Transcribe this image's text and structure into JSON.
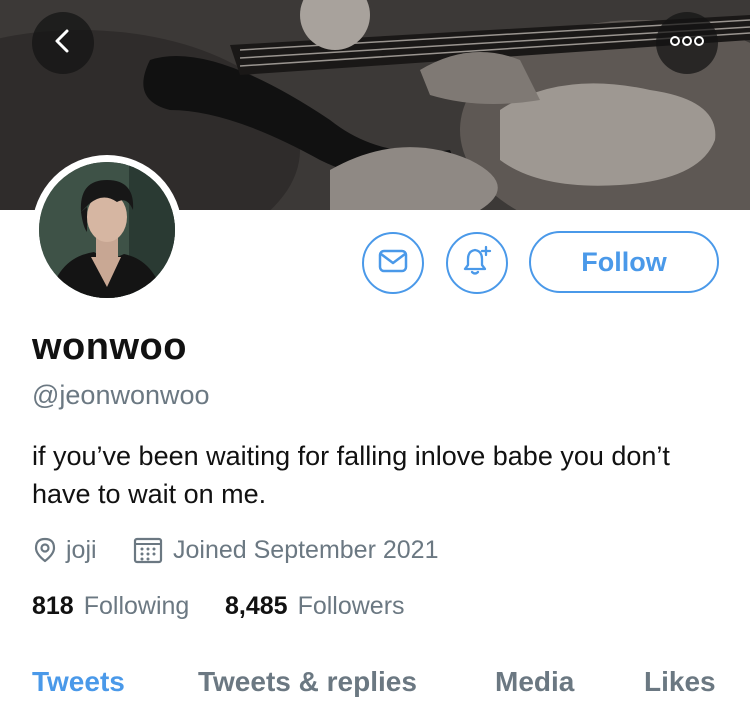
{
  "header": {
    "back_icon": "chevron-left-icon",
    "more_icon": "more-horizontal-icon"
  },
  "profile": {
    "name": "wonwoo",
    "handle": "@jeonwonwoo",
    "bio": "if you’ve been waiting for falling inlove babe you don’t have to wait on me.",
    "location": "joji",
    "joined": "Joined September 2021",
    "following_count": "818",
    "following_label": "Following",
    "followers_count": "8,485",
    "followers_label": "Followers"
  },
  "actions": {
    "message_icon": "mail-icon",
    "notify_icon": "bell-plus-icon",
    "follow_label": "Follow"
  },
  "tabs": [
    {
      "label": "Tweets",
      "active": true
    },
    {
      "label": "Tweets & replies",
      "active": false
    },
    {
      "label": "Media",
      "active": false
    },
    {
      "label": "Likes",
      "active": false
    }
  ],
  "colors": {
    "accent": "#4a99e9",
    "secondary_text": "#6b7882",
    "primary_text": "#111111"
  }
}
